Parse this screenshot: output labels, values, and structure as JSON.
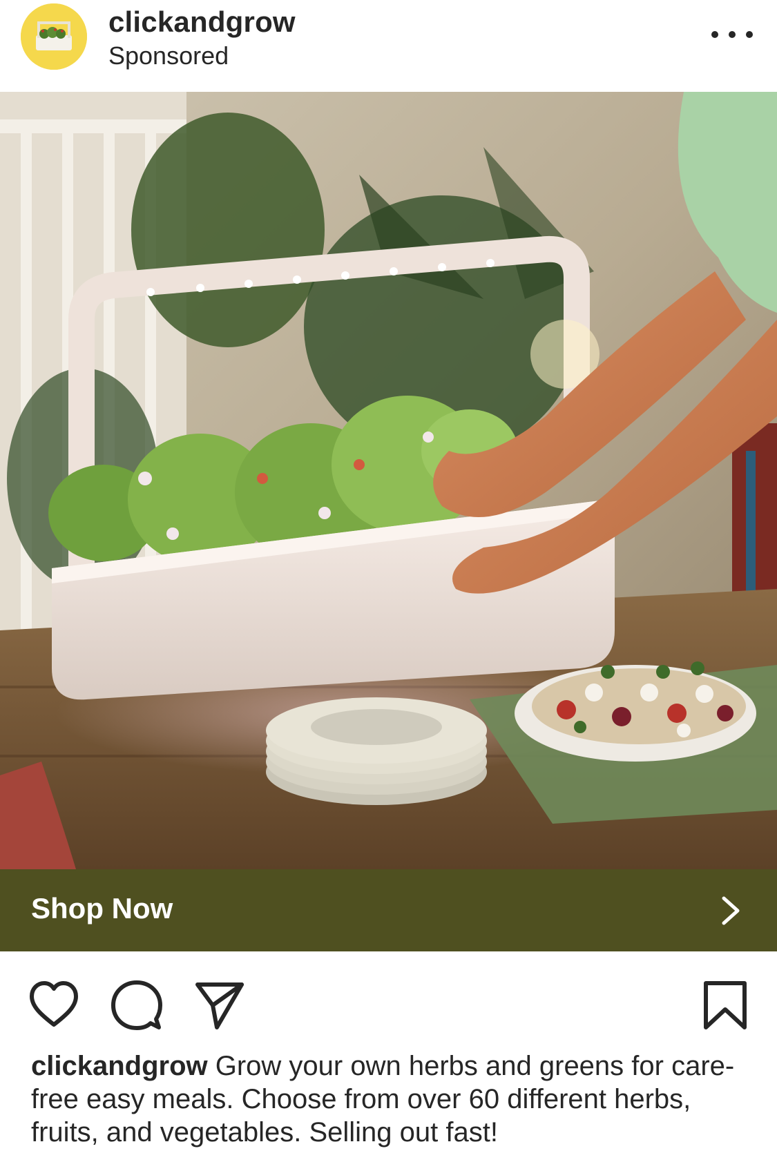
{
  "post": {
    "username": "clickandgrow",
    "sponsored_label": "Sponsored",
    "more_icon": "more-horizontal-icon"
  },
  "cta": {
    "label": "Shop Now",
    "icon": "chevron-right-icon",
    "background": "#4f5020"
  },
  "actions": {
    "like_icon": "heart-icon",
    "comment_icon": "comment-icon",
    "share_icon": "send-icon",
    "save_icon": "bookmark-icon"
  },
  "caption": {
    "username": "clickandgrow",
    "text": "Grow your own herbs and greens for care-free easy meals. Choose from over 60 different herbs, fruits, and vegetables. Selling out fast!"
  }
}
